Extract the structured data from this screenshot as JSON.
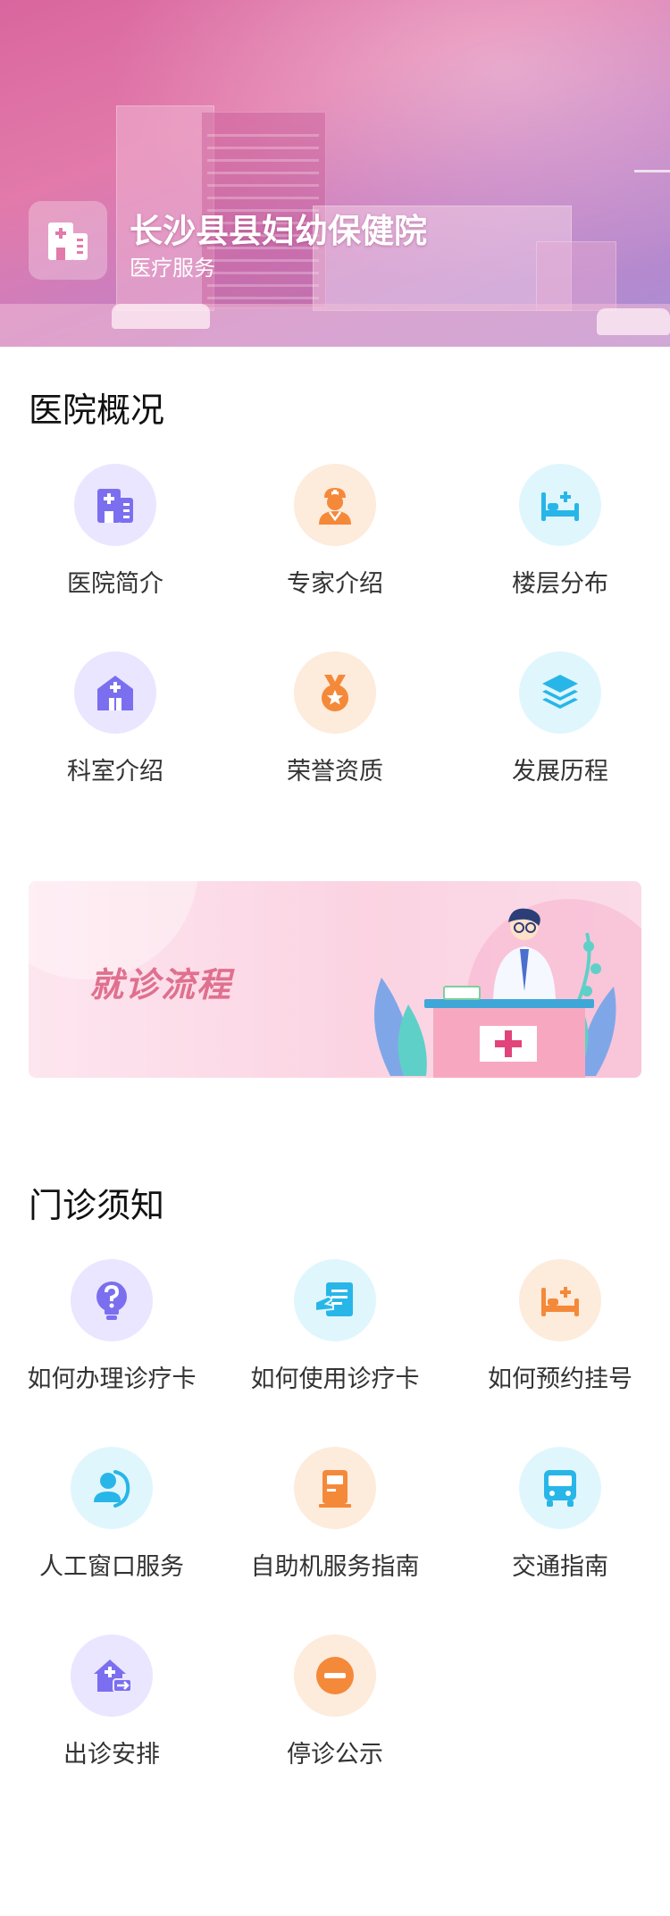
{
  "header": {
    "hospital_name": "长沙县县妇幼保健院",
    "subtitle": "医疗服务",
    "logo_icon": "hospital-building-icon"
  },
  "overview": {
    "title": "医院概况",
    "items": [
      {
        "label": "医院简介",
        "icon": "hospital-building-icon",
        "color": "#7b6ff0"
      },
      {
        "label": "专家介绍",
        "icon": "doctor-icon",
        "color": "#f5893a"
      },
      {
        "label": "楼层分布",
        "icon": "bed-icon",
        "color": "#28b6e8"
      },
      {
        "label": "科室介绍",
        "icon": "department-house-icon",
        "color": "#7b6ff0"
      },
      {
        "label": "荣誉资质",
        "icon": "medal-icon",
        "color": "#f5893a"
      },
      {
        "label": "发展历程",
        "icon": "layers-icon",
        "color": "#28b6e8"
      }
    ]
  },
  "process_banner": {
    "title": "就诊流程",
    "accent_color": "#e0708f"
  },
  "outpatient": {
    "title": "门诊须知",
    "items": [
      {
        "label": "如何办理诊疗卡",
        "icon": "question-bulb-icon",
        "color": "#7b6ff0"
      },
      {
        "label": "如何使用诊疗卡",
        "icon": "card-hand-icon",
        "color": "#28b6e8"
      },
      {
        "label": "如何预约挂号",
        "icon": "bed-icon",
        "color": "#f5893a"
      },
      {
        "label": "人工窗口服务",
        "icon": "service-person-icon",
        "color": "#28b6e8"
      },
      {
        "label": "自助机服务指南",
        "icon": "kiosk-icon",
        "color": "#f5893a"
      },
      {
        "label": "交通指南",
        "icon": "bus-icon",
        "color": "#28b6e8"
      },
      {
        "label": "出诊安排",
        "icon": "house-arrow-icon",
        "color": "#7b6ff0"
      },
      {
        "label": "停诊公示",
        "icon": "minus-circle-icon",
        "color": "#f5893a"
      }
    ]
  }
}
